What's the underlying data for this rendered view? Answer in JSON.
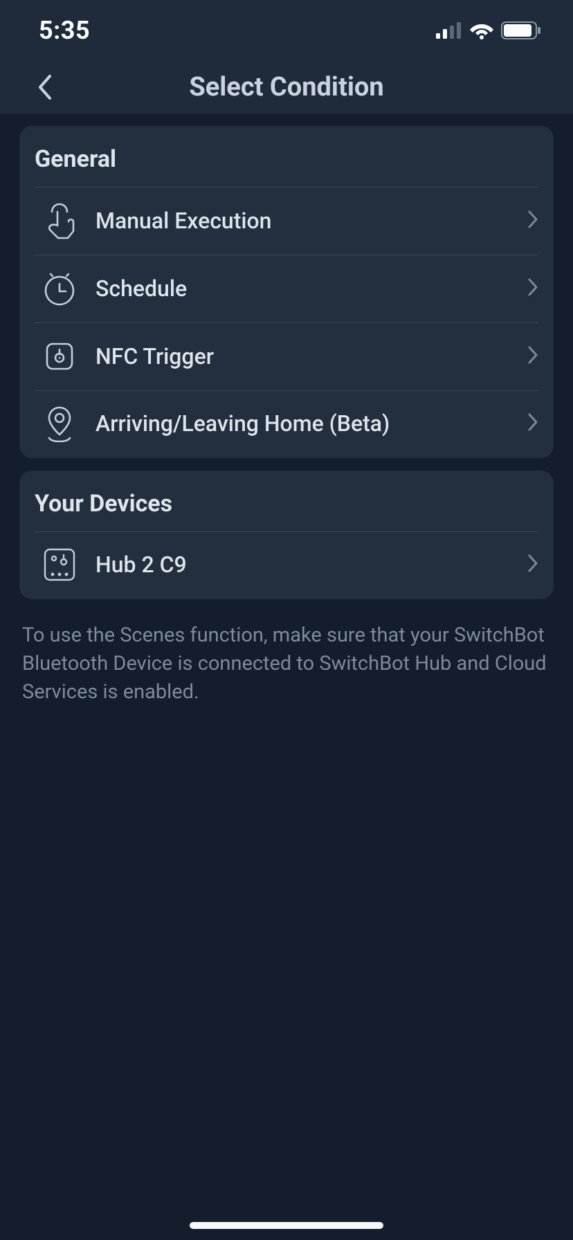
{
  "status": {
    "time": "5:35"
  },
  "nav": {
    "title": "Select Condition"
  },
  "sections": {
    "general": {
      "header": "General",
      "items": {
        "manual": {
          "label": "Manual Execution"
        },
        "schedule": {
          "label": "Schedule"
        },
        "nfc": {
          "label": "NFC Trigger"
        },
        "geo": {
          "label": "Arriving/Leaving Home (Beta)"
        }
      }
    },
    "devices": {
      "header": "Your Devices",
      "items": {
        "hub2c9": {
          "label": "Hub 2 C9"
        }
      }
    }
  },
  "footer_note": "To use the Scenes function, make sure that your SwitchBot Bluetooth Device is connected to SwitchBot Hub and Cloud Services is enabled."
}
